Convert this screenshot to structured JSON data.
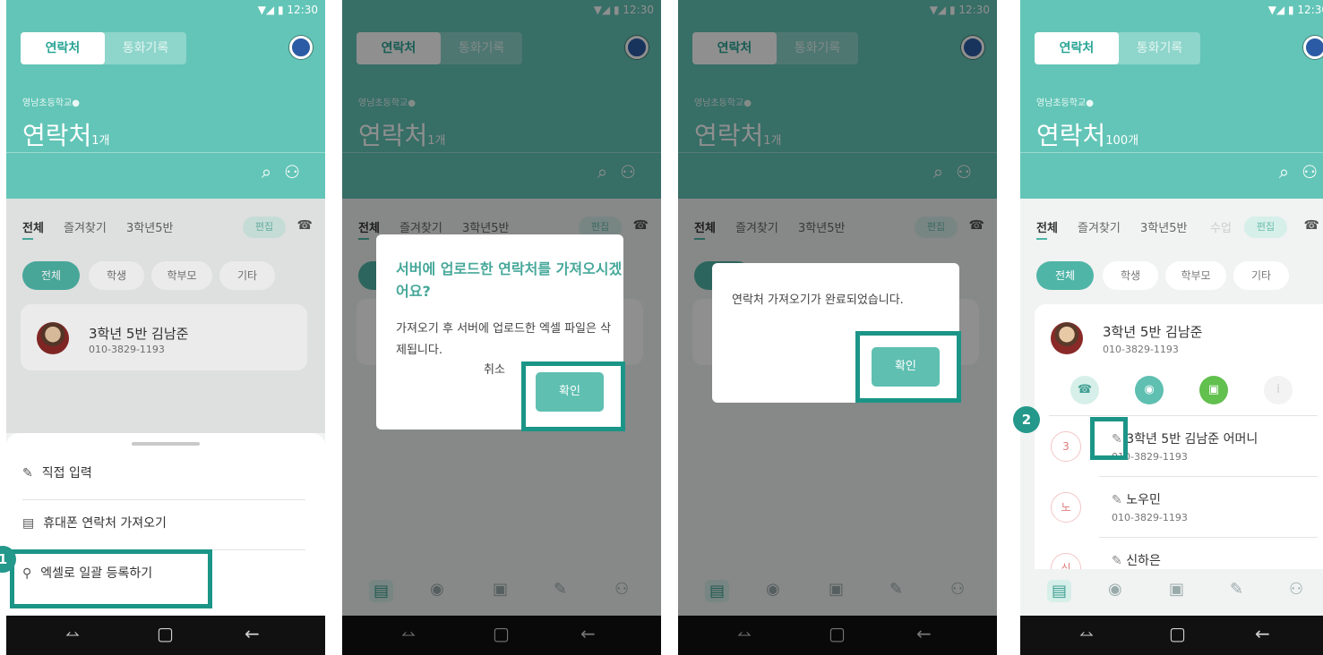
{
  "status_time": "12:30",
  "status_icons": "▼◢ ▮",
  "header": {
    "tab_contacts": "연락처",
    "tab_calls": "통화기록",
    "school": "영남초등학교",
    "school_badge": "●",
    "title": "연락처",
    "count_1": "1개",
    "count_100": "100개"
  },
  "filter_tabs": {
    "all": "전체",
    "favorites": "즐겨찾기",
    "group": "3학년5반",
    "extra": "수업",
    "edit": "편집"
  },
  "pills": [
    "전체",
    "학생",
    "학부모",
    "기타"
  ],
  "contact": {
    "name": "3학년 5반 김남준",
    "phone": "010-3829-1193"
  },
  "sheet": {
    "manual": "직접 입력",
    "phone_import": "휴대폰 연락처 가져오기",
    "excel": "엑셀로 일괄 등록하기"
  },
  "dialog1": {
    "title": "서버에 업로드한 연락처를 가져오시겠어요?",
    "body": "가져오기 후 서버에 업로드한 엑셀 파일은 삭제됩니다.",
    "cancel": "취소",
    "ok": "확인"
  },
  "dialog2": {
    "body": "연락처 가져오기가 완료되었습니다.",
    "ok": "확인"
  },
  "list": [
    {
      "initial": "3",
      "name": "3학년 5반 김남준 어머니",
      "phone": "010-3829-1193"
    },
    {
      "initial": "노",
      "name": "노우민",
      "phone": "010-3829-1193"
    },
    {
      "initial": "신",
      "name": "신하은",
      "phone": ""
    }
  ],
  "badges": {
    "one": "1",
    "two": "2"
  },
  "icons": {
    "search": "⌕",
    "add_person": "⚇",
    "call": "☎",
    "message": "◉",
    "talk": "▣",
    "info": "i",
    "edit": "✎",
    "clip": "⚲",
    "phone_card": "▤",
    "nav_recent": "⥎",
    "nav_home": "▢",
    "nav_back": "←"
  },
  "colors": {
    "teal": "#63c5b7",
    "teal_dark": "#1b9587",
    "dim": "#000000"
  }
}
